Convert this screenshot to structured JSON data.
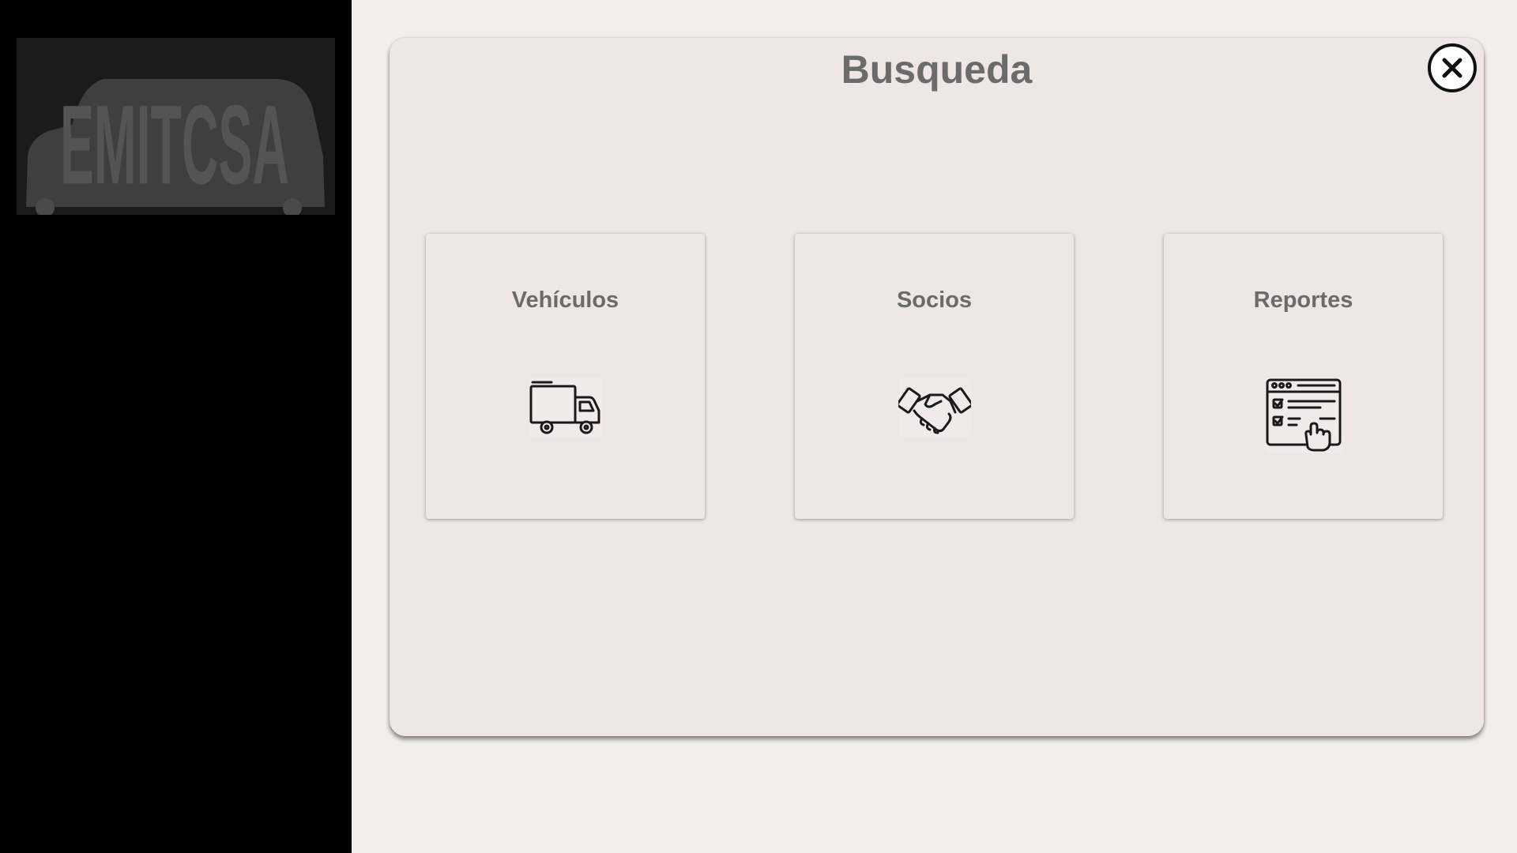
{
  "sidebar": {
    "logo_text": "EMITCSA"
  },
  "panel": {
    "title": "Busqueda",
    "close_icon": "close-circle-icon"
  },
  "cards": [
    {
      "label": "Vehículos",
      "icon": "truck-icon"
    },
    {
      "label": "Socios",
      "icon": "handshake-icon"
    },
    {
      "label": "Reportes",
      "icon": "report-checklist-icon"
    }
  ],
  "colors": {
    "sidebar_bg": "#000000",
    "page_bg": "#f3eeee",
    "panel_bg": "#efe6e6",
    "text": "#6b6b6b",
    "logo_fill": "#4a4a4a"
  }
}
